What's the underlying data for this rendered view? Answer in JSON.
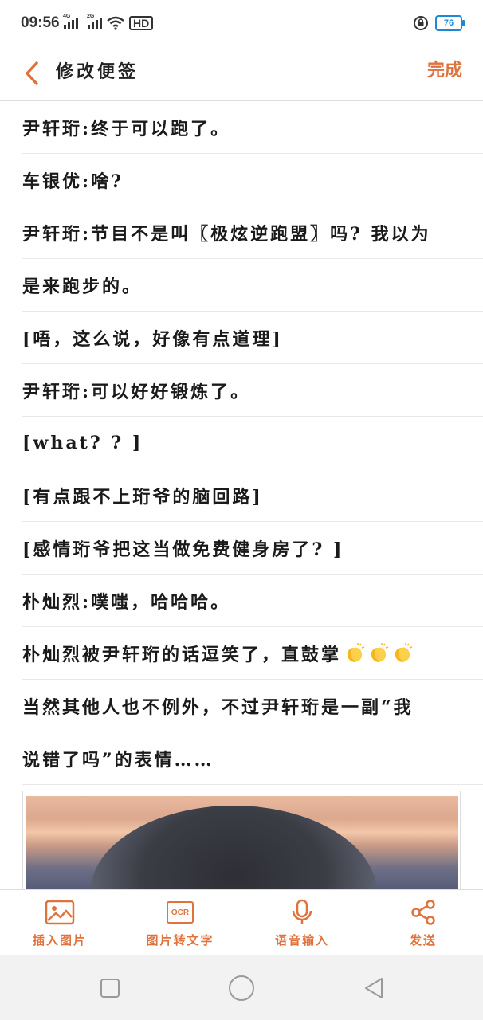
{
  "status_bar": {
    "time": "09:56",
    "net1": "4G",
    "net2": "2G",
    "hd_label": "HD",
    "battery": "76"
  },
  "header": {
    "title": "修改便签",
    "done_label": "完成"
  },
  "note_lines": [
    "尹轩珩:终于可以跑了。",
    "车银优:啥?",
    "尹轩珩:节目不是叫〖极炫逆跑盟〗吗? 我以为",
    "是来跑步的。",
    "[唔，这么说，好像有点道理]",
    "尹轩珩:可以好好锻炼了。",
    "[what? ? ]",
    "[有点跟不上珩爷的脑回路]",
    "[感情珩爷把这当做免费健身房了? ]",
    "朴灿烈:噗嗤，哈哈哈。",
    "朴灿烈被尹轩珩的话逗笑了，直鼓掌",
    "当然其他人也不例外，不过尹轩珩是一副“我",
    "说错了吗”的表情……"
  ],
  "toolbar": {
    "insert_image": "插入图片",
    "ocr_badge": "OCR",
    "ocr": "图片转文字",
    "voice": "语音输入",
    "send": "发送"
  },
  "colors": {
    "accent": "#e0733d",
    "text": "#1a1a1a",
    "divider": "#e8e8e8",
    "battery": "#1e88d6"
  },
  "icons": {
    "back": "chevron-left-icon",
    "image": "image-icon",
    "ocr": "ocr-icon",
    "mic": "microphone-icon",
    "share": "share-icon",
    "clap": "clapping-hands-icon"
  }
}
